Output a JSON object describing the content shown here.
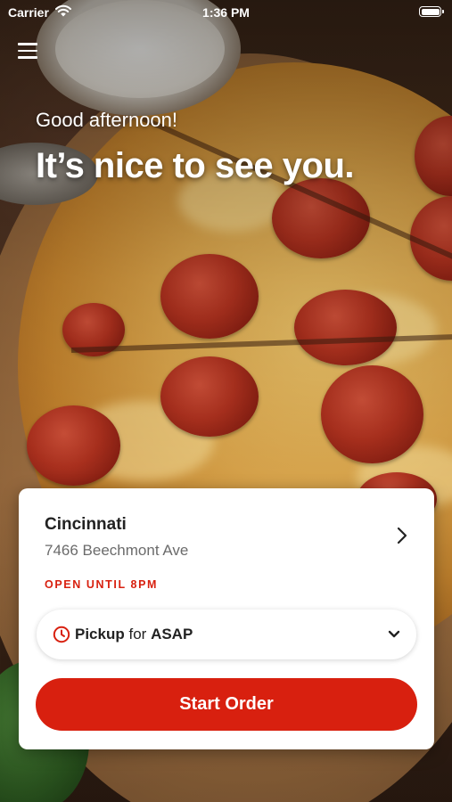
{
  "status_bar": {
    "carrier": "Carrier",
    "time": "1:36 PM",
    "wifi_icon": "wifi-icon",
    "battery_icon": "battery-icon"
  },
  "header": {
    "menu_icon": "hamburger-menu-icon",
    "greeting": "Good afternoon!",
    "headline": "It’s nice to see you."
  },
  "location_card": {
    "city": "Cincinnati",
    "address": "7466 Beechmont Ave",
    "hours": "OPEN UNTIL 8PM",
    "chevron_icon": "chevron-right-icon",
    "order_type": {
      "icon": "clock-icon",
      "mode": "Pickup",
      "connector": "for",
      "time": "ASAP",
      "dropdown_icon": "chevron-down-icon"
    },
    "start_button_label": "Start Order"
  },
  "colors": {
    "accent": "#d8200f",
    "card_background": "#ffffff",
    "text_primary": "#222222",
    "text_secondary": "#6b6b6b"
  }
}
